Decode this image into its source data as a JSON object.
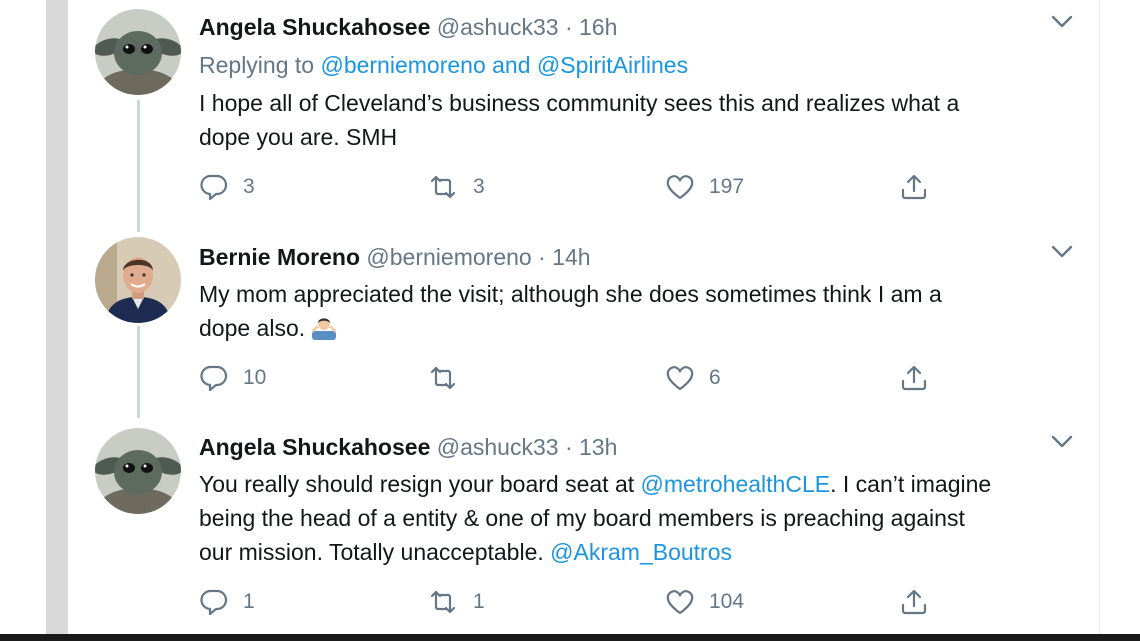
{
  "colors": {
    "link": "#1b95e0",
    "secondary_text": "#657786",
    "primary_text": "#14171a",
    "thread_line": "#ccd6dd"
  },
  "tweets": [
    {
      "name": "Angela Shuckahosee",
      "handle": "@ashuck33",
      "separator": "·",
      "time": "16h",
      "replying_prefix": "Replying to",
      "replying_user1": "@berniemoreno",
      "replying_and": "and",
      "replying_user2": "@SpiritAirlines",
      "text_line1": "I hope all of Cleveland’s business community sees this and realizes what a",
      "text_line2": "dope you are. SMH",
      "replies": "3",
      "retweets": "3",
      "likes": "197",
      "avatar_icon": "baby-yoda-avatar"
    },
    {
      "name": "Bernie Moreno",
      "handle": "@berniemoreno",
      "separator": "·",
      "time": "14h",
      "text_line1": "My mom appreciated the visit; although she does sometimes think I am a",
      "text_line2": "dope also.",
      "emoji": "man-shrugging-emoji",
      "replies": "10",
      "retweets": "",
      "likes": "6",
      "avatar_icon": "man-photo-avatar"
    },
    {
      "name": "Angela Shuckahosee",
      "handle": "@ashuck33",
      "separator": "·",
      "time": "13h",
      "text_line1_a": "You really should resign your board seat at",
      "text_line1_link": "@metrohealthCLE",
      "text_line1_b": ". I can’t imagine",
      "text_line2": "being the head of a entity & one of my board members is preaching against",
      "text_line3_a": "our mission. Totally unacceptable.",
      "text_line3_link": "@Akram_Boutros",
      "replies": "1",
      "retweets": "1",
      "likes": "104",
      "avatar_icon": "baby-yoda-avatar"
    }
  ]
}
